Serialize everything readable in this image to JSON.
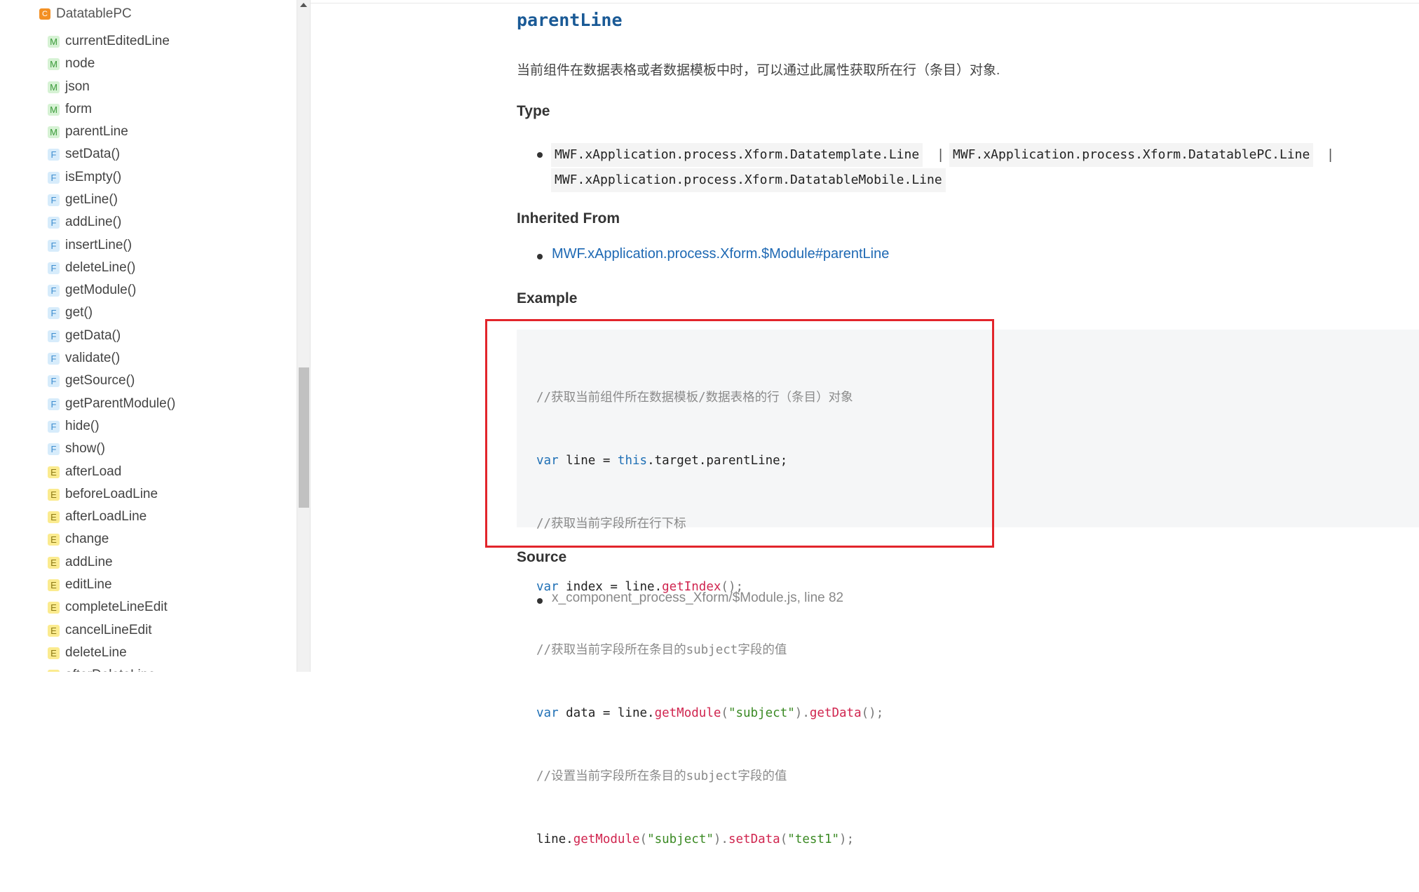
{
  "sidebar": {
    "class_item": {
      "badge": "C",
      "label": "DatatablePC"
    },
    "items": [
      {
        "badge": "M",
        "label": "currentEditedLine"
      },
      {
        "badge": "M",
        "label": "node"
      },
      {
        "badge": "M",
        "label": "json"
      },
      {
        "badge": "M",
        "label": "form"
      },
      {
        "badge": "M",
        "label": "parentLine"
      },
      {
        "badge": "F",
        "label": "setData()"
      },
      {
        "badge": "F",
        "label": "isEmpty()"
      },
      {
        "badge": "F",
        "label": "getLine()"
      },
      {
        "badge": "F",
        "label": "addLine()"
      },
      {
        "badge": "F",
        "label": "insertLine()"
      },
      {
        "badge": "F",
        "label": "deleteLine()"
      },
      {
        "badge": "F",
        "label": "getModule()"
      },
      {
        "badge": "F",
        "label": "get()"
      },
      {
        "badge": "F",
        "label": "getData()"
      },
      {
        "badge": "F",
        "label": "validate()"
      },
      {
        "badge": "F",
        "label": "getSource()"
      },
      {
        "badge": "F",
        "label": "getParentModule()"
      },
      {
        "badge": "F",
        "label": "hide()"
      },
      {
        "badge": "F",
        "label": "show()"
      },
      {
        "badge": "E",
        "label": "afterLoad"
      },
      {
        "badge": "E",
        "label": "beforeLoadLine"
      },
      {
        "badge": "E",
        "label": "afterLoadLine"
      },
      {
        "badge": "E",
        "label": "change"
      },
      {
        "badge": "E",
        "label": "addLine"
      },
      {
        "badge": "E",
        "label": "editLine"
      },
      {
        "badge": "E",
        "label": "completeLineEdit"
      },
      {
        "badge": "E",
        "label": "cancelLineEdit"
      },
      {
        "badge": "E",
        "label": "deleteLine"
      },
      {
        "badge": "E",
        "label": "afterDeleteLine"
      }
    ]
  },
  "main": {
    "title": "parentLine",
    "description": "当前组件在数据表格或者数据模板中时，可以通过此属性获取所在行（条目）对象.",
    "type_heading": "Type",
    "types": [
      "MWF.xApplication.process.Xform.Datatemplate.Line",
      "MWF.xApplication.process.Xform.DatatablePC.Line",
      "MWF.xApplication.process.Xform.DatatableMobile.Line"
    ],
    "type_separator": "|",
    "inherited_heading": "Inherited From",
    "inherited_link": "MWF.xApplication.process.Xform.$Module#parentLine",
    "example_heading": "Example",
    "code": {
      "l1_comment": "//获取当前组件所在数据模板/数据表格的行（条目）对象",
      "l2_kw": "var",
      "l2_a": " line = ",
      "l2_this": "this",
      "l2_b": ".target.parentLine;",
      "l3_comment": "//获取当前字段所在行下标",
      "l4_kw": "var",
      "l4_a": " index = line.",
      "l4_fn": "getIndex",
      "l4_b": "();",
      "l5_comment": "//获取当前字段所在条目的subject字段的值",
      "l6_kw": "var",
      "l6_a": " data = line.",
      "l6_fn1": "getModule",
      "l6_p1": "(",
      "l6_str": "\"subject\"",
      "l6_p2": ").",
      "l6_fn2": "getData",
      "l6_p3": "();",
      "l7_comment": "//设置当前字段所在条目的subject字段的值",
      "l8_a": "line.",
      "l8_fn1": "getModule",
      "l8_p1": "(",
      "l8_str1": "\"subject\"",
      "l8_p2": ").",
      "l8_fn2": "setData",
      "l8_p3": "(",
      "l8_str2": "\"test1\"",
      "l8_p4": ");"
    },
    "source_heading": "Source",
    "source_text": "x_component_process_Xform/$Module.js, line 82"
  },
  "colors": {
    "link": "#1d68b3",
    "title": "#1a5a96",
    "highlight_border": "#e2252b"
  }
}
